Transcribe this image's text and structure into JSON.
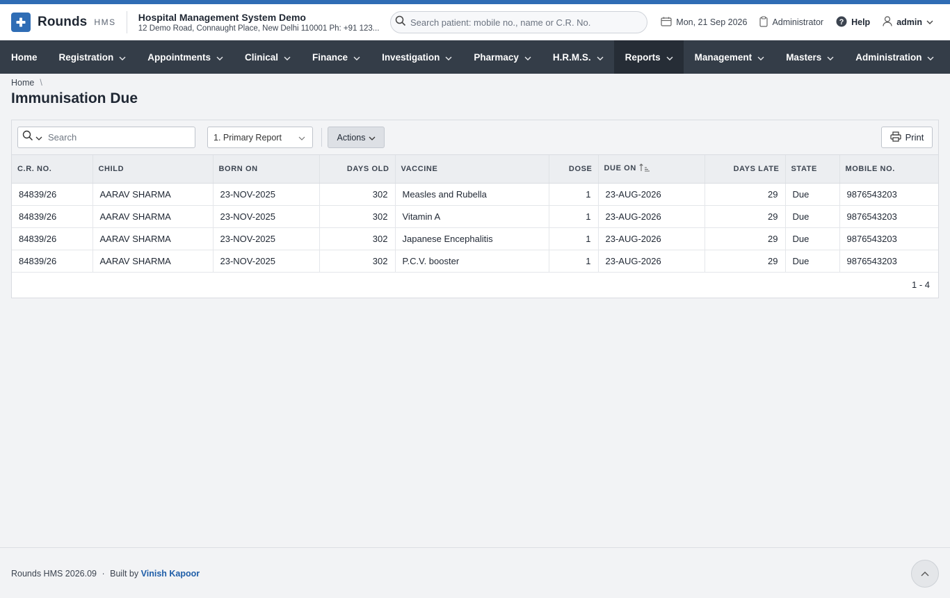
{
  "app": {
    "name": "Rounds",
    "suffix": "HMS",
    "org_name": "Hospital Management System Demo",
    "org_address": "12 Demo Road, Connaught Place, New Delhi 110001 Ph: +91 123...",
    "brand_color": "#2f6db5"
  },
  "header": {
    "search_placeholder": "Search patient: mobile no., name or C.R. No.",
    "date": "Mon, 21 Sep 2026",
    "role": "Administrator",
    "help": "Help",
    "user": "admin"
  },
  "nav": [
    {
      "label": "Home",
      "dropdown": false,
      "active": false
    },
    {
      "label": "Registration",
      "dropdown": true,
      "active": false
    },
    {
      "label": "Appointments",
      "dropdown": true,
      "active": false
    },
    {
      "label": "Clinical",
      "dropdown": true,
      "active": false
    },
    {
      "label": "Finance",
      "dropdown": true,
      "active": false
    },
    {
      "label": "Investigation",
      "dropdown": true,
      "active": false
    },
    {
      "label": "Pharmacy",
      "dropdown": true,
      "active": false
    },
    {
      "label": "H.R.M.S.",
      "dropdown": true,
      "active": false
    },
    {
      "label": "Reports",
      "dropdown": true,
      "active": true
    },
    {
      "label": "Management",
      "dropdown": true,
      "active": false
    },
    {
      "label": "Masters",
      "dropdown": true,
      "active": false
    },
    {
      "label": "Administration",
      "dropdown": true,
      "active": false
    }
  ],
  "breadcrumb": {
    "home": "Home",
    "separator": "\\"
  },
  "page": {
    "title": "Immunisation Due"
  },
  "toolbar": {
    "search_placeholder": "Search",
    "report_select": "1. Primary Report",
    "actions": "Actions",
    "print": "Print"
  },
  "table": {
    "columns": [
      "C.R. NO.",
      "CHILD",
      "BORN ON",
      "DAYS OLD",
      "VACCINE",
      "DOSE",
      "DUE ON",
      "DAYS LATE",
      "STATE",
      "MOBILE NO."
    ],
    "sorted_column": "DUE ON",
    "rows": [
      [
        "84839/26",
        "AARAV SHARMA",
        "23-NOV-2025",
        "302",
        "Measles and Rubella",
        "1",
        "23-AUG-2026",
        "29",
        "Due",
        "9876543203"
      ],
      [
        "84839/26",
        "AARAV SHARMA",
        "23-NOV-2025",
        "302",
        "Vitamin A",
        "1",
        "23-AUG-2026",
        "29",
        "Due",
        "9876543203"
      ],
      [
        "84839/26",
        "AARAV SHARMA",
        "23-NOV-2025",
        "302",
        "Japanese Encephalitis",
        "1",
        "23-AUG-2026",
        "29",
        "Due",
        "9876543203"
      ],
      [
        "84839/26",
        "AARAV SHARMA",
        "23-NOV-2025",
        "302",
        "P.C.V. booster",
        "1",
        "23-AUG-2026",
        "29",
        "Due",
        "9876543203"
      ]
    ],
    "pagination": "1 - 4"
  },
  "footer": {
    "version": "Rounds HMS 2026.09",
    "dot": "·",
    "built_by": "Built by",
    "author": "Vinish Kapoor"
  }
}
